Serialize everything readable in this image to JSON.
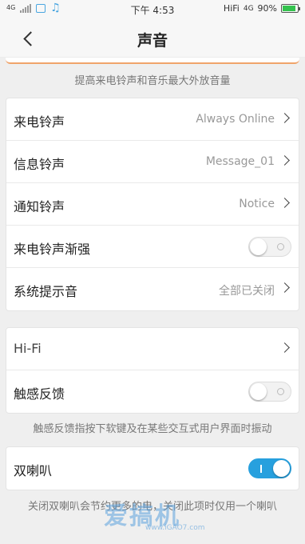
{
  "status_bar": {
    "network_left": "4G",
    "time": "下午 4:53",
    "hifi": "HiFi",
    "network_right": "4G",
    "battery": "90%",
    "battery_level": 0.9
  },
  "nav": {
    "title": "声音"
  },
  "top_caption": "提高来电铃声和音乐最大外放音量",
  "group1": [
    {
      "label": "来电铃声",
      "value": "Always Online"
    },
    {
      "label": "信息铃声",
      "value": "Message_01"
    },
    {
      "label": "通知铃声",
      "value": "Notice"
    },
    {
      "label": "来电铃声渐强",
      "toggle": false
    },
    {
      "label": "系统提示音",
      "value": "全部已关闭"
    }
  ],
  "group2": [
    {
      "label": "Hi-Fi"
    },
    {
      "label": "触感反馈",
      "toggle": false
    }
  ],
  "haptic_caption": "触感反馈指按下软键及在某些交互式用户界面时振动",
  "group3": [
    {
      "label": "双喇叭",
      "toggle": true
    }
  ],
  "speaker_caption": "关闭双喇叭会节约更多的电，关闭此项时仅用一个喇叭",
  "watermark": {
    "text": "爱搞机",
    "sub": "www.iGAO7.com"
  },
  "colors": {
    "accent": "#27a0de",
    "battery": "#33c24d",
    "orange_line": "#f0a46b"
  }
}
